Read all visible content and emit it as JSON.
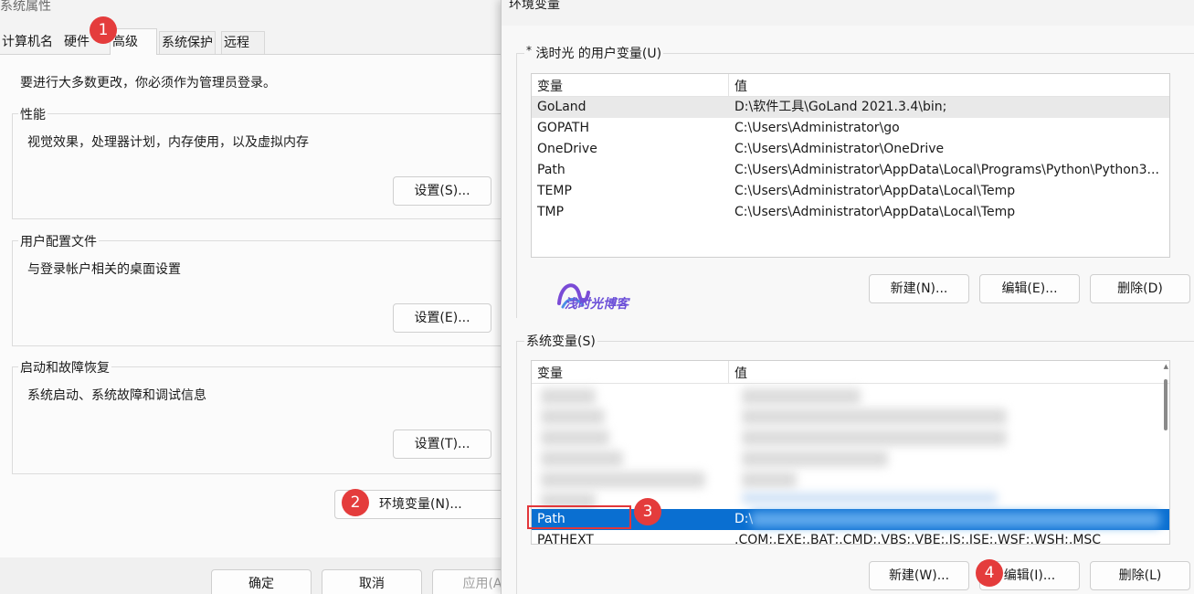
{
  "sysprops": {
    "title": "系统属性",
    "tabs": [
      "计算机名",
      "硬件",
      "高级",
      "系统保护",
      "远程"
    ],
    "notice": "要进行大多数更改，你必须作为管理员登录。",
    "performance": {
      "title": "性能",
      "desc": "视觉效果，处理器计划，内存使用，以及虚拟内存",
      "button": "设置(S)..."
    },
    "profiles": {
      "title": "用户配置文件",
      "desc": "与登录帐户相关的桌面设置",
      "button": "设置(E)..."
    },
    "startup": {
      "title": "启动和故障恢复",
      "desc": "系统启动、系统故障和调试信息",
      "button": "设置(T)..."
    },
    "env_button": "环境变量(N)...",
    "footer": {
      "ok": "确定",
      "cancel": "取消",
      "apply": "应用(A"
    }
  },
  "envvars": {
    "title": "环境变量",
    "user_section": "浅时光 的用户变量(U)",
    "user_marker": "*",
    "columns": {
      "name": "变量",
      "value": "值"
    },
    "user_vars": [
      {
        "name": "GoLand",
        "value": "D:\\软件工具\\GoLand 2021.3.4\\bin;"
      },
      {
        "name": "GOPATH",
        "value": "C:\\Users\\Administrator\\go"
      },
      {
        "name": "OneDrive",
        "value": "C:\\Users\\Administrator\\OneDrive"
      },
      {
        "name": "Path",
        "value": "C:\\Users\\Administrator\\AppData\\Local\\Programs\\Python\\Python3..."
      },
      {
        "name": "TEMP",
        "value": "C:\\Users\\Administrator\\AppData\\Local\\Temp"
      },
      {
        "name": "TMP",
        "value": "C:\\Users\\Administrator\\AppData\\Local\\Temp"
      }
    ],
    "user_buttons": {
      "new": "新建(N)...",
      "edit": "编辑(E)...",
      "delete": "删除(D)"
    },
    "system_section": "系统变量(S)",
    "system_selected": {
      "name": "Path",
      "value": "D:\\"
    },
    "system_next": {
      "name": "PATHEXT",
      "value": ".COM;.EXE;.BAT;.CMD;.VBS;.VBE;.JS;.JSE;.WSF;.WSH;.MSC"
    },
    "system_buttons": {
      "new": "新建(W)...",
      "edit": "编辑(I)...",
      "delete": "删除(L)"
    }
  },
  "logo_text": "浅时光博客",
  "badges": [
    "1",
    "2",
    "3",
    "4"
  ],
  "colors": {
    "badge": "#e43c3c",
    "selection": "#0a6fd1",
    "annotation_box": "#e2363a"
  }
}
